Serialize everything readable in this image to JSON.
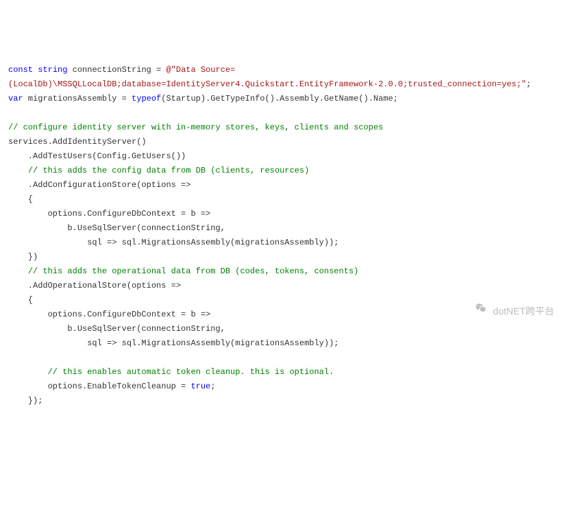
{
  "code": {
    "l1": {
      "t1": "const",
      "t2": " ",
      "t3": "string",
      "t4": " connectionString = ",
      "t5": "@\"Data Source="
    },
    "l2": {
      "t1": "(LocalDb)\\MSSQLLocalDB;database=IdentityServer4.Quickstart.EntityFramework-2.0.0;trusted_connection=yes;\"",
      "t2": ";"
    },
    "l3": {
      "t1": "var",
      "t2": " migrationsAssembly = ",
      "t3": "typeof",
      "t4": "(Startup).GetTypeInfo().Assembly.GetName().Name;"
    },
    "l4": {
      "t1": ""
    },
    "l5": {
      "t1": "// configure identity server with in-memory stores, keys, clients and scopes"
    },
    "l6": {
      "t1": "services.AddIdentityServer()"
    },
    "l7": {
      "t1": "    .AddTestUsers(Config.GetUsers())"
    },
    "l8": {
      "t1": "    ",
      "t2": "// this adds the config data from DB (clients, resources)"
    },
    "l9": {
      "t1": "    .AddConfigurationStore(options =>"
    },
    "l10": {
      "t1": "    {"
    },
    "l11": {
      "t1": "        options.ConfigureDbContext = b =>"
    },
    "l12": {
      "t1": "            b.UseSqlServer(connectionString,"
    },
    "l13": {
      "t1": "                sql => sql.MigrationsAssembly(migrationsAssembly));"
    },
    "l14": {
      "t1": "    })"
    },
    "l15": {
      "t1": "    ",
      "t2": "// this adds the operational data from DB (codes, tokens, consents)"
    },
    "l16": {
      "t1": "    .AddOperationalStore(options =>"
    },
    "l17": {
      "t1": "    {"
    },
    "l18": {
      "t1": "        options.ConfigureDbContext = b =>"
    },
    "l19": {
      "t1": "            b.UseSqlServer(connectionString,"
    },
    "l20": {
      "t1": "                sql => sql.MigrationsAssembly(migrationsAssembly));"
    },
    "l21": {
      "t1": ""
    },
    "l22": {
      "t1": "        ",
      "t2": "// this enables automatic token cleanup. this is optional."
    },
    "l23": {
      "t1": "        options.EnableTokenCleanup = ",
      "t2": "true",
      "t3": ";"
    },
    "l24": {
      "t1": "    });"
    }
  },
  "watermark": {
    "text": "dotNET跨平台"
  }
}
